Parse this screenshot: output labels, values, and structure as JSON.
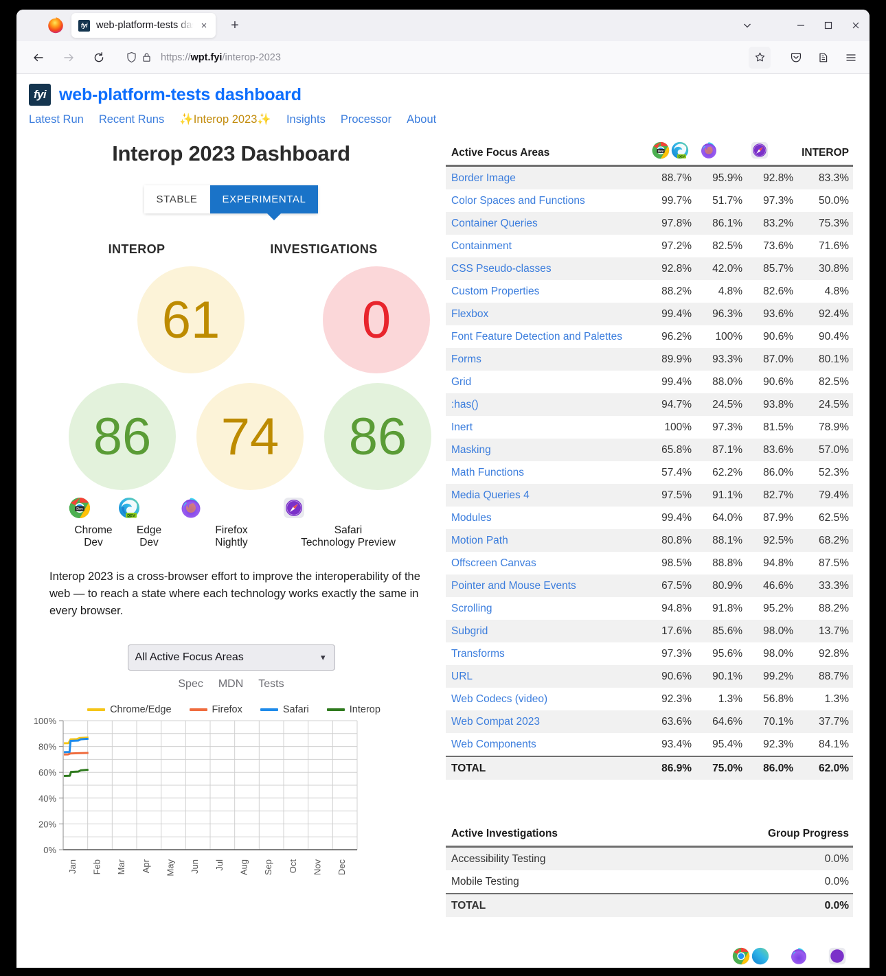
{
  "browser": {
    "tab_title": "web-platform-tests dashb",
    "tab_favicon_text": "fyi",
    "url_scheme": "https://",
    "url_domain": "wpt.fyi",
    "url_path": "/interop-2023",
    "new_tab_label": "+",
    "close_label": "×",
    "window_minimize": "—",
    "window_maximize": "□",
    "window_close": "✕"
  },
  "site": {
    "logo_text": "fyi",
    "title": "web-platform-tests dashboard",
    "nav": [
      {
        "label": "Latest Run",
        "highlight": false
      },
      {
        "label": "Recent Runs",
        "highlight": false
      },
      {
        "label": "✨Interop 2023✨",
        "highlight": true
      },
      {
        "label": "Insights",
        "highlight": false
      },
      {
        "label": "Processor",
        "highlight": false
      },
      {
        "label": "About",
        "highlight": false
      }
    ]
  },
  "dashboard": {
    "page_title": "Interop 2023 Dashboard",
    "toggle": {
      "stable": "STABLE",
      "experimental": "EXPERIMENTAL",
      "selected": "EXPERIMENTAL"
    },
    "score_labels": {
      "interop": "INTEROP",
      "investigations": "INVESTIGATIONS"
    },
    "scores": {
      "interop": "61",
      "investigations": "0",
      "chrome_edge": "86",
      "firefox": "74",
      "safari": "86"
    },
    "browsers": [
      {
        "name": "Chrome\nDev",
        "line1": "Chrome",
        "line2": "Dev",
        "icon": "chrome-dev-icon"
      },
      {
        "name": "Edge\nDev",
        "line1": "Edge",
        "line2": "Dev",
        "icon": "edge-dev-icon"
      },
      {
        "name": "Firefox\nNightly",
        "line1": "Firefox",
        "line2": "Nightly",
        "icon": "firefox-nightly-icon"
      },
      {
        "name": "Safari Technology Preview",
        "line1": "Safari",
        "line2": "Technology Preview",
        "icon": "safari-tp-icon"
      }
    ],
    "description": "Interop 2023 is a cross-browser effort to improve the interoperability of the web — to reach a state where each technology works exactly the same in every browser.",
    "focus_select": {
      "value": "All Active Focus Areas"
    },
    "spec_links": [
      "Spec",
      "MDN",
      "Tests"
    ],
    "colors": {
      "brand_blue": "#0d6efd",
      "link_blue": "#3b7ddd",
      "yellow": "#bd8b00",
      "yellow_bg": "#fcf3d8",
      "green": "#5a9c36",
      "green_bg": "#e3f2dc",
      "red": "#e8252d",
      "red_bg": "#fbd7d9",
      "accent": "#1a73c8"
    }
  },
  "chart_data": {
    "type": "line",
    "title": "",
    "xlabel": "",
    "ylabel": "",
    "ylim": [
      0,
      100
    ],
    "ytick_labels": [
      "100%",
      "80%",
      "60%",
      "40%",
      "20%",
      "0%"
    ],
    "yticks": [
      100,
      80,
      60,
      40,
      20,
      0
    ],
    "categories": [
      "Jan",
      "Feb",
      "Mar",
      "Apr",
      "May",
      "Jun",
      "Jul",
      "Aug",
      "Sep",
      "Oct",
      "Nov",
      "Dec"
    ],
    "grid": true,
    "legend_position": "top",
    "series": [
      {
        "name": "Chrome/Edge",
        "color": "#f5c518",
        "points": [
          [
            0.03,
            82.5
          ],
          [
            0.22,
            82.6
          ],
          [
            0.3,
            85.5
          ],
          [
            0.55,
            85.7
          ],
          [
            0.68,
            86.6
          ],
          [
            1.03,
            86.9
          ]
        ]
      },
      {
        "name": "Firefox",
        "color": "#ef6c3e",
        "points": [
          [
            0.03,
            73.8
          ],
          [
            0.2,
            73.9
          ],
          [
            0.3,
            74.6
          ],
          [
            0.6,
            74.8
          ],
          [
            1.03,
            75.0
          ]
        ]
      },
      {
        "name": "Safari",
        "color": "#1f8bea",
        "points": [
          [
            0.03,
            75.6
          ],
          [
            0.26,
            75.7
          ],
          [
            0.3,
            84.3
          ],
          [
            0.62,
            84.6
          ],
          [
            0.72,
            85.6
          ],
          [
            1.03,
            86.0
          ]
        ]
      },
      {
        "name": "Interop",
        "color": "#2f7a1e",
        "points": [
          [
            0.03,
            57.2
          ],
          [
            0.27,
            57.3
          ],
          [
            0.32,
            60.3
          ],
          [
            0.62,
            60.6
          ],
          [
            0.72,
            61.5
          ],
          [
            1.03,
            62.0
          ]
        ]
      }
    ]
  },
  "focus_table": {
    "header": {
      "name": "Active Focus Areas",
      "chrome_edge_icon": "chrome-edge-icons",
      "firefox_icon": "firefox-icon",
      "safari_icon": "safari-icon",
      "interop": "INTEROP"
    },
    "rows": [
      {
        "name": "Border Image",
        "values": [
          "88.7%",
          "95.9%",
          "92.8%",
          "83.3%"
        ]
      },
      {
        "name": "Color Spaces and Functions",
        "values": [
          "99.7%",
          "51.7%",
          "97.3%",
          "50.0%"
        ]
      },
      {
        "name": "Container Queries",
        "values": [
          "97.8%",
          "86.1%",
          "83.2%",
          "75.3%"
        ]
      },
      {
        "name": "Containment",
        "values": [
          "97.2%",
          "82.5%",
          "73.6%",
          "71.6%"
        ]
      },
      {
        "name": "CSS Pseudo-classes",
        "values": [
          "92.8%",
          "42.0%",
          "85.7%",
          "30.8%"
        ]
      },
      {
        "name": "Custom Properties",
        "values": [
          "88.2%",
          "4.8%",
          "82.6%",
          "4.8%"
        ]
      },
      {
        "name": "Flexbox",
        "values": [
          "99.4%",
          "96.3%",
          "93.6%",
          "92.4%"
        ]
      },
      {
        "name": "Font Feature Detection and Palettes",
        "values": [
          "96.2%",
          "100%",
          "90.6%",
          "90.4%"
        ]
      },
      {
        "name": "Forms",
        "values": [
          "89.9%",
          "93.3%",
          "87.0%",
          "80.1%"
        ]
      },
      {
        "name": "Grid",
        "values": [
          "99.4%",
          "88.0%",
          "90.6%",
          "82.5%"
        ]
      },
      {
        "name": ":has()",
        "values": [
          "94.7%",
          "24.5%",
          "93.8%",
          "24.5%"
        ]
      },
      {
        "name": "Inert",
        "values": [
          "100%",
          "97.3%",
          "81.5%",
          "78.9%"
        ]
      },
      {
        "name": "Masking",
        "values": [
          "65.8%",
          "87.1%",
          "83.6%",
          "57.0%"
        ]
      },
      {
        "name": "Math Functions",
        "values": [
          "57.4%",
          "62.2%",
          "86.0%",
          "52.3%"
        ]
      },
      {
        "name": "Media Queries 4",
        "values": [
          "97.5%",
          "91.1%",
          "82.7%",
          "79.4%"
        ]
      },
      {
        "name": "Modules",
        "values": [
          "99.4%",
          "64.0%",
          "87.9%",
          "62.5%"
        ]
      },
      {
        "name": "Motion Path",
        "values": [
          "80.8%",
          "88.1%",
          "92.5%",
          "68.2%"
        ]
      },
      {
        "name": "Offscreen Canvas",
        "values": [
          "98.5%",
          "88.8%",
          "94.8%",
          "87.5%"
        ]
      },
      {
        "name": "Pointer and Mouse Events",
        "values": [
          "67.5%",
          "80.9%",
          "46.6%",
          "33.3%"
        ]
      },
      {
        "name": "Scrolling",
        "values": [
          "94.8%",
          "91.8%",
          "95.2%",
          "88.2%"
        ]
      },
      {
        "name": "Subgrid",
        "values": [
          "17.6%",
          "85.6%",
          "98.0%",
          "13.7%"
        ]
      },
      {
        "name": "Transforms",
        "values": [
          "97.3%",
          "95.6%",
          "98.0%",
          "92.8%"
        ]
      },
      {
        "name": "URL",
        "values": [
          "90.6%",
          "90.1%",
          "99.2%",
          "88.7%"
        ]
      },
      {
        "name": "Web Codecs (video)",
        "values": [
          "92.3%",
          "1.3%",
          "56.8%",
          "1.3%"
        ]
      },
      {
        "name": "Web Compat 2023",
        "values": [
          "63.6%",
          "64.6%",
          "70.1%",
          "37.7%"
        ]
      },
      {
        "name": "Web Components",
        "values": [
          "93.4%",
          "95.4%",
          "92.3%",
          "84.1%"
        ]
      }
    ],
    "total": {
      "name": "TOTAL",
      "values": [
        "86.9%",
        "75.0%",
        "86.0%",
        "62.0%"
      ]
    }
  },
  "investigations_table": {
    "header": {
      "name": "Active Investigations",
      "progress": "Group Progress"
    },
    "rows": [
      {
        "name": "Accessibility Testing",
        "value": "0.0%"
      },
      {
        "name": "Mobile Testing",
        "value": "0.0%"
      }
    ],
    "total": {
      "name": "TOTAL",
      "value": "0.0%"
    }
  }
}
